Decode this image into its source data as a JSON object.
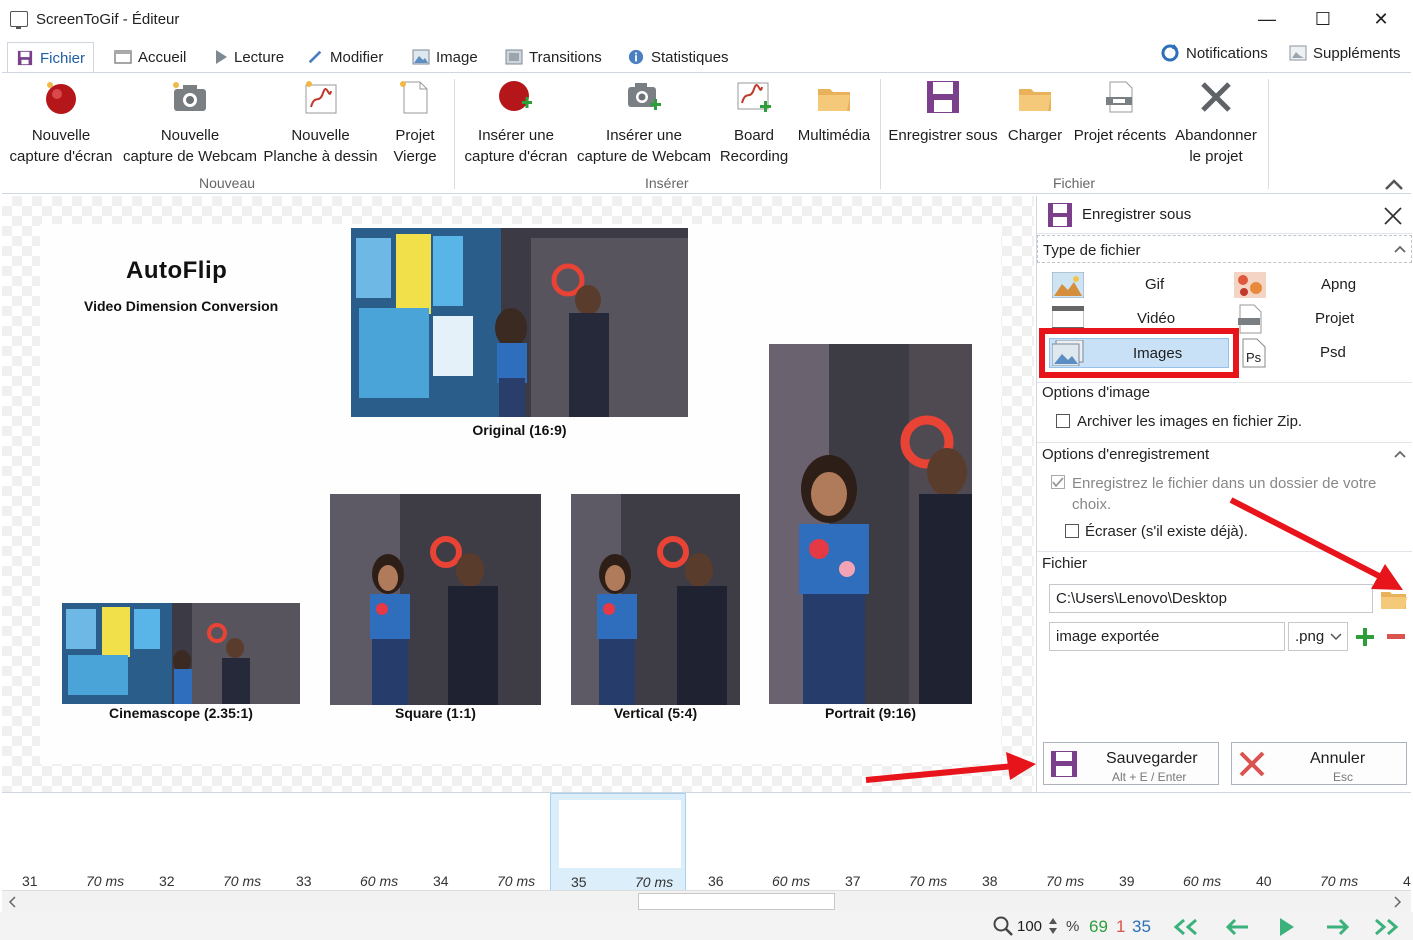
{
  "window": {
    "title": "ScreenToGif - Éditeur",
    "minimize": "—",
    "maximize": "☐",
    "close": "✕"
  },
  "tabs": [
    {
      "label": "Fichier"
    },
    {
      "label": "Accueil"
    },
    {
      "label": "Lecture"
    },
    {
      "label": "Modifier"
    },
    {
      "label": "Image"
    },
    {
      "label": "Transitions"
    },
    {
      "label": "Statistiques"
    }
  ],
  "top_right": {
    "notifications": "Notifications",
    "extras": "Suppléments"
  },
  "ribbon": {
    "nouveau": {
      "label": "Nouveau",
      "screen_capture": [
        "Nouvelle",
        "capture d'écran"
      ],
      "webcam_capture": [
        "Nouvelle",
        "capture de Webcam"
      ],
      "board": [
        "Nouvelle",
        "Planche à dessin"
      ],
      "blank_project": [
        "Projet",
        "Vierge"
      ]
    },
    "inserer": {
      "label": "Insérer",
      "insert_screen": [
        "Insérer une",
        "capture d'écran"
      ],
      "insert_webcam": [
        "Insérer une",
        "capture de Webcam"
      ],
      "board_recording": [
        "Board",
        "Recording"
      ],
      "media": "Multimédia"
    },
    "fichier": {
      "label": "Fichier",
      "save_as": "Enregistrer sous",
      "load": "Charger",
      "recent": "Projet récents",
      "discard": [
        "Abandonner",
        "le projet"
      ]
    }
  },
  "frame": {
    "title": "AutoFlip",
    "subtitle": "Video Dimension Conversion",
    "captions": {
      "original": "Original (16:9)",
      "cinemascope": "Cinemascope (2.35:1)",
      "square": "Square (1:1)",
      "vertical": "Vertical (5:4)",
      "portrait": "Portrait (9:16)"
    }
  },
  "panel": {
    "title": "Enregistrer sous",
    "file_type_label": "Type de fichier",
    "types": {
      "gif": "Gif",
      "apng": "Apng",
      "video": "Vidéo",
      "project": "Projet",
      "images": "Images",
      "psd": "Psd"
    },
    "image_options_label": "Options d'image",
    "zip_option": "Archiver les images en fichier Zip.",
    "save_options_label": "Options d'enregistrement",
    "save_folder_option_l1": "Enregistrez le fichier dans un dossier de votre",
    "save_folder_option_l2": "choix.",
    "overwrite_option": "Écraser (s'il existe déjà).",
    "file_label": "Fichier",
    "folder_value": "C:\\Users\\Lenovo\\Desktop",
    "filename_value": "image exportée",
    "extension_value": ".png",
    "save_button": "Sauvegarder",
    "save_shortcut": "Alt + E / Enter",
    "cancel_button": "Annuler",
    "cancel_shortcut": "Esc"
  },
  "timeline": [
    {
      "num": "31",
      "ms": "70 ms"
    },
    {
      "num": "32",
      "ms": "70 ms"
    },
    {
      "num": "33",
      "ms": "60 ms"
    },
    {
      "num": "34",
      "ms": "70 ms"
    },
    {
      "num": "35",
      "ms": "70 ms"
    },
    {
      "num": "36",
      "ms": "60 ms"
    },
    {
      "num": "37",
      "ms": "70 ms"
    },
    {
      "num": "38",
      "ms": "70 ms"
    },
    {
      "num": "39",
      "ms": "60 ms"
    },
    {
      "num": "40",
      "ms": "70 ms"
    },
    {
      "num": "4",
      "ms": ""
    }
  ],
  "status": {
    "zoom": "100",
    "zoom_unit": "%",
    "total": "69",
    "selected": "1",
    "current": "35"
  },
  "colors": {
    "accent_blue": "#1f5fa6",
    "highlight_red": "#e8141b",
    "green": "#2e9e3a",
    "nav_green": "#3bb27c"
  }
}
